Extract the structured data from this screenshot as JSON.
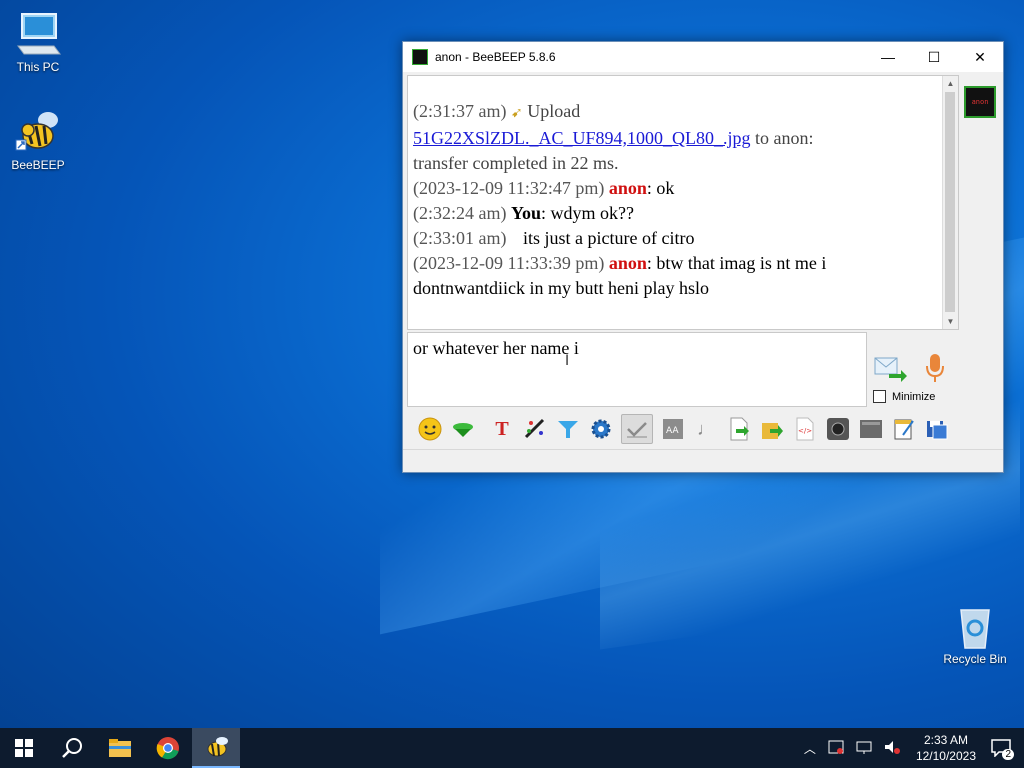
{
  "desktop": {
    "icons": [
      {
        "label": "This PC",
        "icon": "computer-icon"
      },
      {
        "label": "BeeBEEP",
        "icon": "bee-icon"
      },
      {
        "label": "Recycle Bin",
        "icon": "recycle-bin-icon"
      }
    ]
  },
  "window": {
    "title": "anon - BeeBEEP 5.8.6",
    "controls": {
      "minimize": "—",
      "maximize": "☐",
      "close": "✕"
    },
    "avatar_text": "anon",
    "chat": {
      "upload": {
        "time": "(2:31:37 am)",
        "label": "Upload",
        "file": "51G22XSlZDL._AC_UF894,1000_QL80_.jpg",
        "suffix": "to anon:",
        "line2": "transfer completed in 22 ms."
      },
      "messages": [
        {
          "time": "(2023-12-09 11:32:47 pm)",
          "sender": "anon",
          "text": ": ok"
        },
        {
          "time": "(2:32:24 am)",
          "sender": "You",
          "text": ": wdym ok??"
        },
        {
          "time": "(2:33:01 am)",
          "sender": "",
          "text": "its just a picture of citro"
        },
        {
          "time": "(2023-12-09 11:33:39 pm)",
          "sender": "anon",
          "text": ": btw that imag is nt me i dontnwantdiick in my butt heni play hslo"
        }
      ]
    },
    "input": {
      "value": "or whatever her name i"
    },
    "minimize_label": "Minimize",
    "toolbar": [
      "emoticons-icon",
      "save-chat-icon",
      "font-icon",
      "color-icon",
      "filter-icon",
      "settings-icon",
      "spell-check-icon",
      "font-size-icon",
      "sound-icon",
      "send-file-icon",
      "send-folder-icon",
      "html-icon",
      "screenshot-icon",
      "media-icon",
      "notes-icon",
      "save-icon"
    ]
  },
  "taskbar": {
    "items": [
      "start-icon",
      "search-icon",
      "file-explorer-icon",
      "chrome-icon",
      "beebeep-icon"
    ],
    "time": "2:33 AM",
    "date": "12/10/2023",
    "notifications": "2"
  }
}
